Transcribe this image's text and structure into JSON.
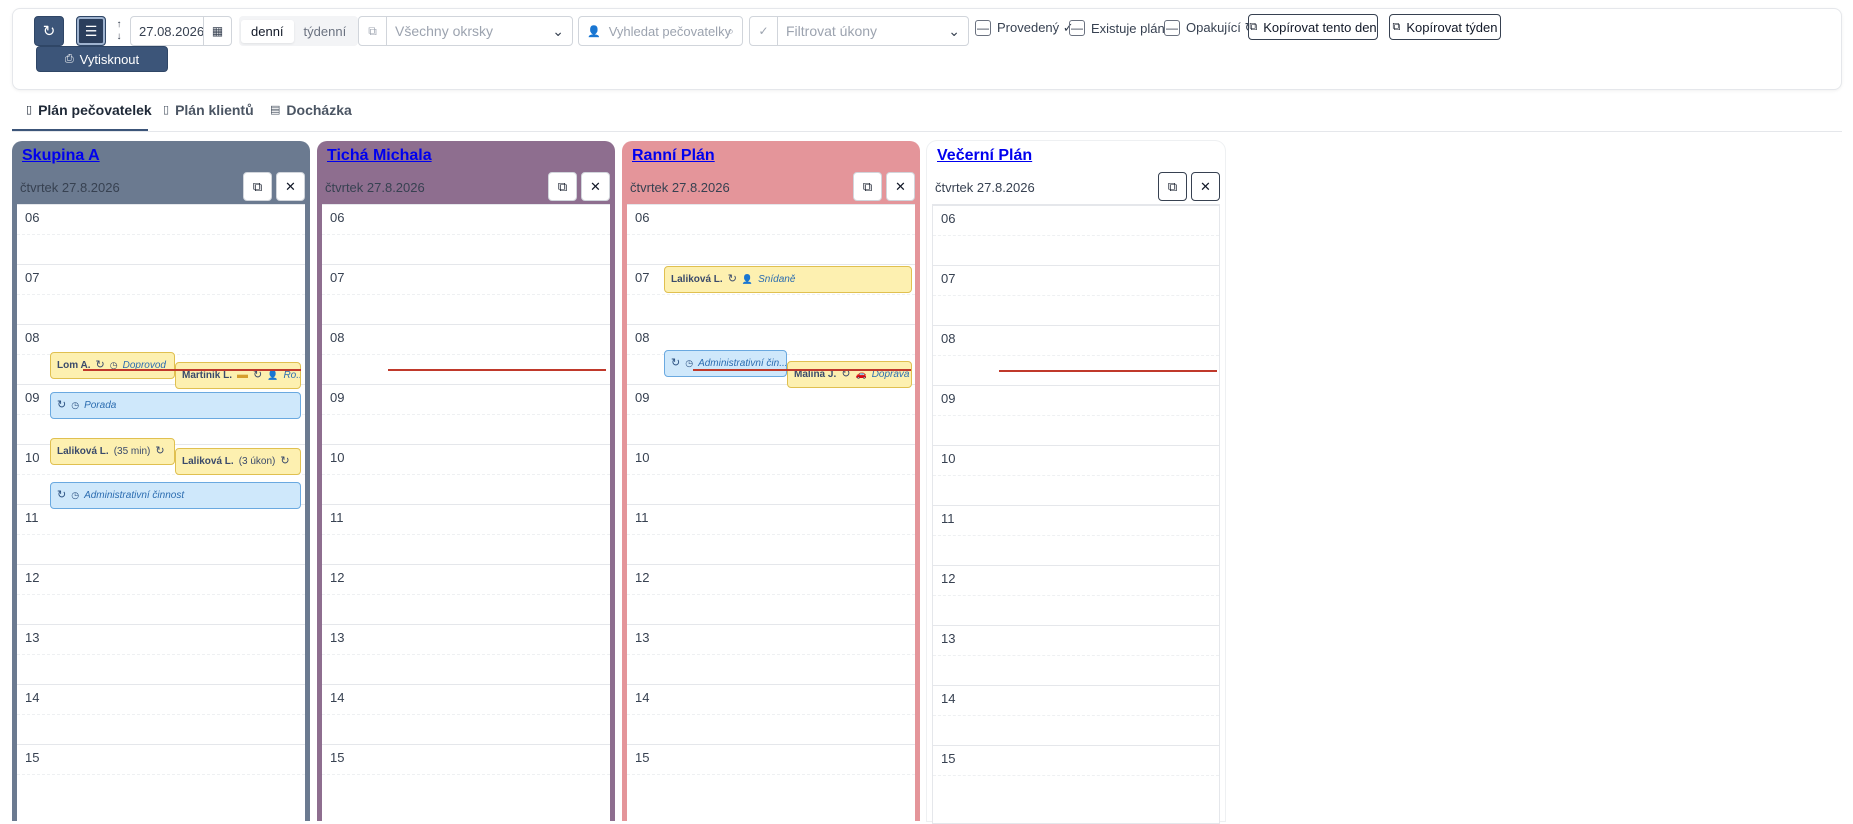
{
  "toolbar": {
    "date_value": "27.08.2026",
    "view_daily": "denní",
    "view_weekly": "týdenní",
    "district_placeholder": "Všechny okrsky",
    "search_placeholder": "Vyhledat pečovatelky",
    "tasks_placeholder": "Filtrovat úkony",
    "check_done": "Provedený ✓",
    "check_plan": "Existuje plán",
    "check_repeat": "Opakující ↻",
    "copy_day": "Kopírovat tento den",
    "copy_week": "Kopírovat týden",
    "print": "Vytisknout"
  },
  "tabs": {
    "caregivers": "Plán pečovatelek",
    "clients": "Plán klientů",
    "attendance": "Docházka"
  },
  "hours": [
    "06",
    "07",
    "08",
    "09",
    "10",
    "11",
    "12",
    "13",
    "14",
    "15"
  ],
  "colors": {
    "skupina_a": "#6b7a90",
    "ticha": "#8e6e8f",
    "ranni": "#e4959a",
    "vecerni": "#ffffff",
    "event_yellow": "#fdf0b0",
    "event_blue": "#cfe8fb",
    "now_line": "#c0392b",
    "primary": "#3c5579"
  },
  "columns": [
    {
      "title": "Skupina A",
      "date": "čtvrtek 27.8.2026",
      "events": [
        {
          "name": "Lom A.",
          "task": "Doprovod"
        },
        {
          "name": "Martinik L.",
          "task": "Ro..."
        },
        {
          "task": "Porada"
        },
        {
          "name": "Laliková L.",
          "duration": "(35 min)"
        },
        {
          "name": "Laliková L.",
          "duration": "(3 úkon)"
        },
        {
          "task": "Administrativní činnost"
        }
      ]
    },
    {
      "title": "Tichá Michala",
      "date": "čtvrtek 27.8.2026",
      "events": []
    },
    {
      "title": "Ranní Plán",
      "date": "čtvrtek 27.8.2026",
      "events": [
        {
          "name": "Laliková L.",
          "task": "Snídaně"
        },
        {
          "task": "Administrativní čin..."
        },
        {
          "name": "Malina J.",
          "task": "Doprava"
        }
      ]
    },
    {
      "title": "Večerní Plán",
      "date": "čtvrtek 27.8.2026",
      "events": []
    }
  ]
}
